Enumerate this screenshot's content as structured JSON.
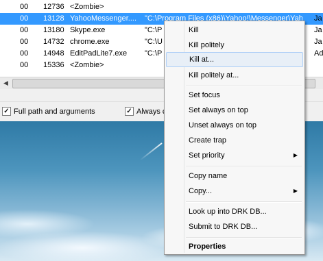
{
  "process_list": {
    "rows": [
      {
        "a": "00",
        "pid": "12736",
        "name": "<Zombie>",
        "cmd": "",
        "extra": "",
        "selected": false
      },
      {
        "a": "00",
        "pid": "13128",
        "name": "YahooMessenger....",
        "cmd": "\"C:\\Program Files (x86)\\Yahoo!\\Messenger\\Yah...",
        "extra": "Ja",
        "selected": true
      },
      {
        "a": "00",
        "pid": "13180",
        "name": "Skype.exe",
        "cmd": "\"C:\\P",
        "extra": "Ja",
        "selected": false
      },
      {
        "a": "00",
        "pid": "14732",
        "name": "chrome.exe",
        "cmd": "\"C:\\U",
        "extra": "Ja",
        "selected": false
      },
      {
        "a": "00",
        "pid": "14948",
        "name": "EditPadLite7.exe",
        "cmd": "\"C:\\P",
        "extra": "Ad",
        "selected": false
      },
      {
        "a": "00",
        "pid": "15336",
        "name": "<Zombie>",
        "cmd": "",
        "extra": "",
        "selected": false
      }
    ]
  },
  "scrollbar": {
    "left_arrow": "◀"
  },
  "options": {
    "full_path_label": "Full path and arguments",
    "always_label": "Always c",
    "check_mark": "✓"
  },
  "context_menu": {
    "items": [
      {
        "label": "Kill"
      },
      {
        "label": "Kill politely"
      },
      {
        "label": "Kill at..."
      },
      {
        "label": "Kill politely at..."
      },
      {
        "label": "Set focus"
      },
      {
        "label": "Set always on top"
      },
      {
        "label": "Unset always on top"
      },
      {
        "label": "Create trap"
      },
      {
        "label": "Set priority"
      },
      {
        "label": "Copy name"
      },
      {
        "label": "Copy..."
      },
      {
        "label": "Look up into DRK DB..."
      },
      {
        "label": "Submit to DRK DB..."
      },
      {
        "label": "Properties"
      }
    ],
    "submenu_arrow": "▶"
  }
}
